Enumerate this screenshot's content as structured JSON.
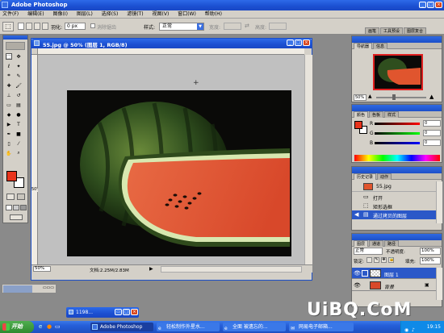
{
  "title_bar": {
    "app_title": "Adobe Photoshop"
  },
  "menu_bar": {
    "items": [
      "文件(F)",
      "编辑(E)",
      "图像(I)",
      "图层(L)",
      "选择(S)",
      "滤镜(T)",
      "视图(V)",
      "窗口(W)",
      "帮助(H)"
    ]
  },
  "options_bar": {
    "feather_label": "羽化:",
    "feather_value": "0 px",
    "antialias_label": "消除锯齿",
    "style_label": "样式:",
    "style_value": "正常",
    "width_label": "宽度:",
    "height_label": "高度:",
    "dock_tabs": [
      "画笔",
      "工具预设",
      "图层复合"
    ]
  },
  "document": {
    "title": "55.jpg @ 50% (图层 1, RGB/8)",
    "zoom": "50%",
    "doc_info": "文档:2.25M/2.83M",
    "ruler_zoom": "50%"
  },
  "navigator": {
    "tabs": [
      "导航器",
      "信息"
    ],
    "zoom": "50%"
  },
  "color_panel": {
    "tabs": [
      "颜色",
      "色板",
      "样式"
    ],
    "channels": [
      {
        "label": "R",
        "value": "0"
      },
      {
        "label": "G",
        "value": "0"
      },
      {
        "label": "B",
        "value": "0"
      }
    ]
  },
  "history": {
    "tabs": [
      "历史记录",
      "动作"
    ],
    "snapshot": "55.jpg",
    "items": [
      "打开",
      "矩形选框",
      "通过拷贝的图层"
    ]
  },
  "layers": {
    "tabs": [
      "图层",
      "通道",
      "路径"
    ],
    "blend_mode": "正常",
    "opacity_label": "不透明度:",
    "opacity_value": "100%",
    "lock_label": "锁定:",
    "fill_label": "填充:",
    "fill_value": "100%",
    "items": [
      "图层 1",
      "背景"
    ]
  },
  "min_window": {
    "title": "1198..."
  },
  "taskbar": {
    "start_label": "开始",
    "buttons": [
      "Adobe Photoshop",
      "轻松制作外星水...",
      "全面  被遗忘的...",
      "网易电子邮箱..."
    ],
    "clock": "19:15"
  },
  "watermark": "UiBQ.CoM",
  "colors": {
    "accent": "#1c4fc8",
    "foreground": "#e8341c",
    "background": "#ffffff",
    "selected_row": "#2b58c8"
  }
}
